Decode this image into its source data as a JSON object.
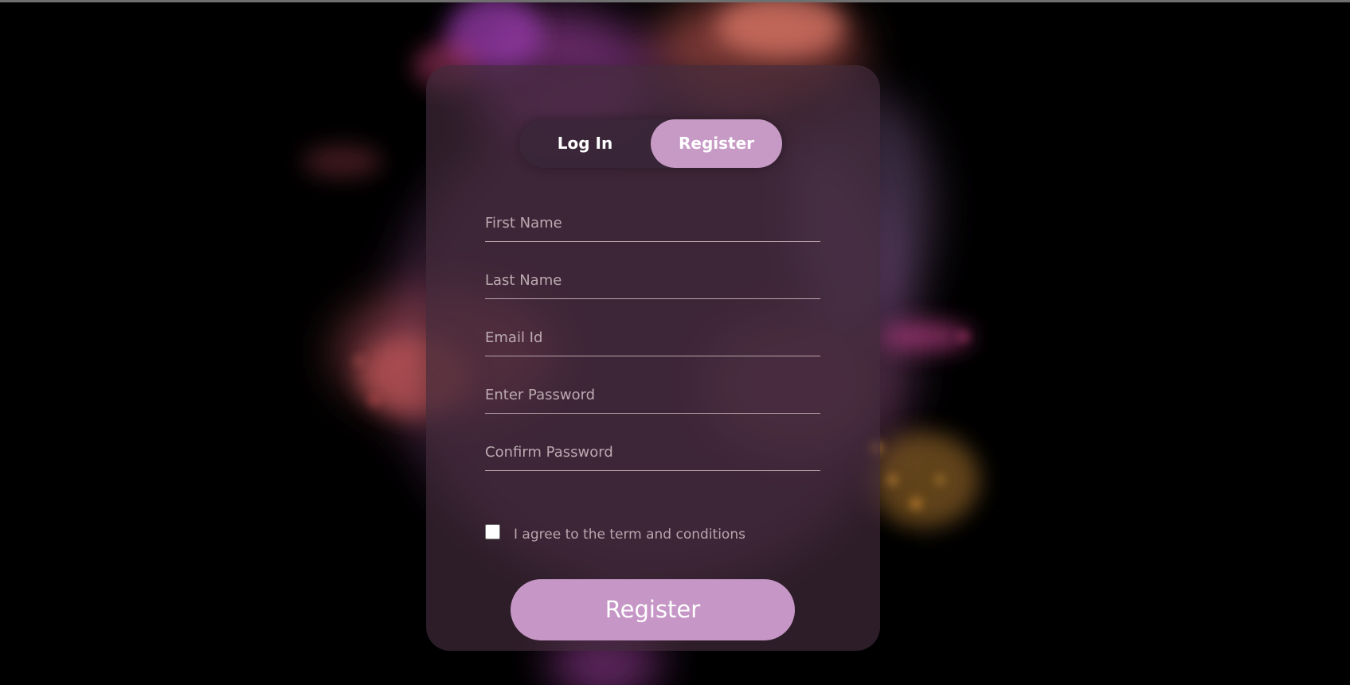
{
  "tabs": {
    "login_label": "Log In",
    "register_label": "Register",
    "active": "Register"
  },
  "form": {
    "first_name_placeholder": "First Name",
    "last_name_placeholder": "Last Name",
    "email_placeholder": "Email Id",
    "password_placeholder": "Enter Password",
    "confirm_password_placeholder": "Confirm Password",
    "first_name_value": "",
    "last_name_value": "",
    "email_value": "",
    "password_value": "",
    "confirm_password_value": "",
    "terms_label": "I agree to the term and conditions",
    "terms_checked": false,
    "submit_label": "Register"
  },
  "colors": {
    "accent": "#c79ac6",
    "card": "#3e2838",
    "background": "#000000",
    "field_line": "#b9a3a8"
  }
}
